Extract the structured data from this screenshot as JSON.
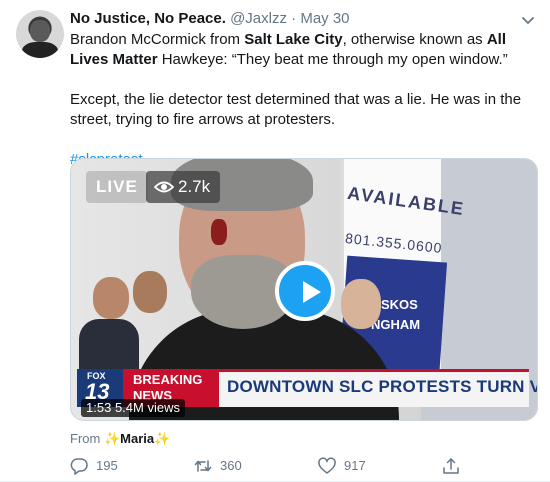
{
  "tweet": {
    "author_name": "No Justice, No Peace.",
    "handle": "@Jaxlzz",
    "separator": "·",
    "date": "May 30",
    "text": {
      "p1_part1": "Brandon McCormick from ",
      "p1_bold1": "Salt Lake City",
      "p1_part2": ", otherwise known as ",
      "p1_bold2": "All Lives Matter",
      "p1_part3": " Hawkeye: “They beat me through my open window.”",
      "p2": "Except, the lie detector test determined that was a lie. He was in the street, trying to fire arrows at protesters.",
      "hashtag": "#slcprotest"
    }
  },
  "video": {
    "live_label": "LIVE",
    "views": "2.7k",
    "duration": "1:53",
    "total_views": "5.4M views",
    "lower_third": {
      "station_brand": "FOX",
      "station_number": "13",
      "breaking_line1": "BREAKING",
      "breaking_line2": "NEWS",
      "headline": "DOWNTOWN SLC PROTESTS TURN VIOLENT"
    },
    "sign": {
      "available": "AVAILABLE",
      "phone": "801.355.0600",
      "line1": "SKOS",
      "line2": "NGHAM"
    }
  },
  "source": {
    "from_label": "From",
    "sparkle_left": "✨",
    "account": "Maria",
    "sparkle_right": "✨"
  },
  "actions": {
    "replies": "195",
    "retweets": "360",
    "likes": "917"
  },
  "colors": {
    "accent": "#1da1f2",
    "hashtag": "#1b95e0",
    "secondary_text": "#657786",
    "breaking_red": "#c8102e",
    "fox_blue": "#1b3a7a"
  },
  "icons": {
    "caret": "chevron-down-icon",
    "views": "eye-icon",
    "play": "play-icon",
    "reply": "reply-icon",
    "retweet": "retweet-icon",
    "like": "heart-icon",
    "share": "share-icon"
  }
}
